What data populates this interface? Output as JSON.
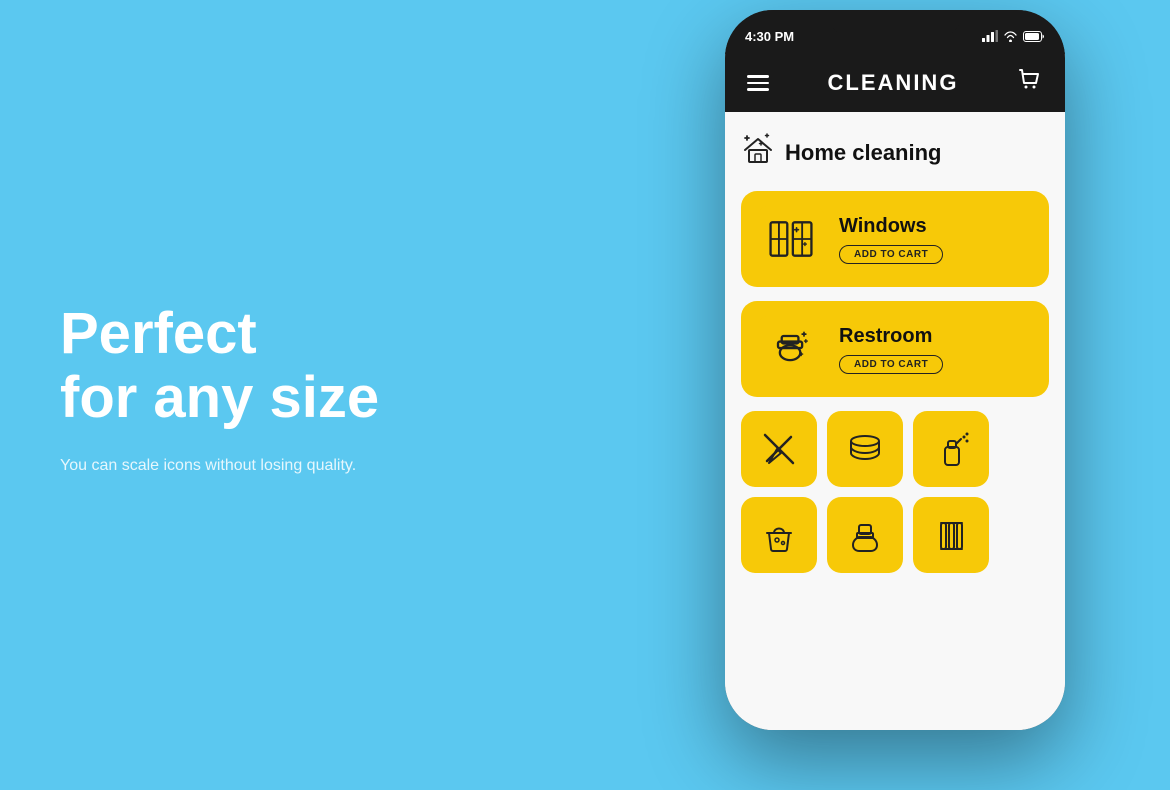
{
  "background_color": "#5BC8F0",
  "left": {
    "headline_line1": "Perfect",
    "headline_line2": "for any size",
    "subtext": "You can scale icons without losing quality."
  },
  "phone": {
    "status_bar": {
      "time": "4:30 PM",
      "signal_icon": "signal-bars-icon",
      "wifi_icon": "wifi-icon",
      "battery_icon": "battery-icon"
    },
    "header": {
      "menu_label": "menu",
      "title": "CLEANING",
      "cart_label": "cart"
    },
    "section": {
      "icon": "home-cleaning-icon",
      "title": "Home cleaning"
    },
    "cards": [
      {
        "id": "windows",
        "name": "Windows",
        "cta": "ADD TO CART",
        "icon": "windows-icon"
      },
      {
        "id": "restroom",
        "name": "Restroom",
        "cta": "ADD TO CART",
        "icon": "restroom-icon"
      }
    ],
    "small_icons": [
      {
        "id": "broom-icon",
        "label": "broom"
      },
      {
        "id": "filter-icon",
        "label": "filter"
      },
      {
        "id": "spray-icon",
        "label": "spray"
      }
    ],
    "small_icons_row2": [
      {
        "id": "bucket-icon",
        "label": "bucket"
      },
      {
        "id": "toilet-icon",
        "label": "toilet"
      },
      {
        "id": "mop-icon",
        "label": "mop"
      }
    ]
  }
}
